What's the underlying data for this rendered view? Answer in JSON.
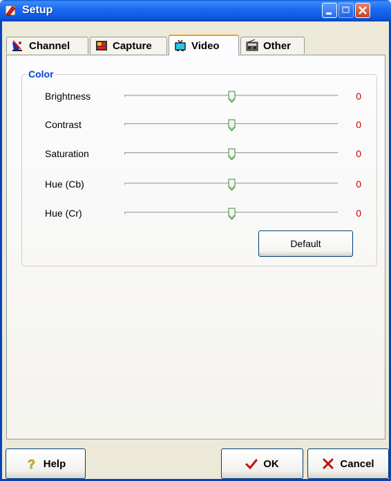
{
  "window": {
    "title": "Setup",
    "app_icon": "setup-app-icon",
    "controls": [
      "minimize-icon",
      "maximize-icon",
      "close-icon"
    ]
  },
  "tabs": [
    {
      "label": "Channel",
      "icon": "satellite-dish-icon",
      "active": false
    },
    {
      "label": "Capture",
      "icon": "capture-card-icon",
      "active": false
    },
    {
      "label": "Video",
      "icon": "tv-icon",
      "active": true
    },
    {
      "label": "Other",
      "icon": "radio-icon",
      "active": false
    }
  ],
  "color_group": {
    "title": "Color",
    "rows": [
      {
        "label": "Brightness",
        "value": "0",
        "position": 0.5
      },
      {
        "label": "Contrast",
        "value": "0",
        "position": 0.5
      },
      {
        "label": "Saturation",
        "value": "0",
        "position": 0.5
      },
      {
        "label": "Hue (Cb)",
        "value": "0",
        "position": 0.5
      },
      {
        "label": "Hue (Cr)",
        "value": "0",
        "position": 0.5
      }
    ],
    "default_label": "Default"
  },
  "footer": {
    "help_label": "Help",
    "ok_label": "OK",
    "cancel_label": "Cancel"
  },
  "colors": {
    "titlebar": "#0b56de",
    "group_title": "#0046d5",
    "value_red": "#c00000",
    "active_tab_accent": "#f0a020"
  }
}
